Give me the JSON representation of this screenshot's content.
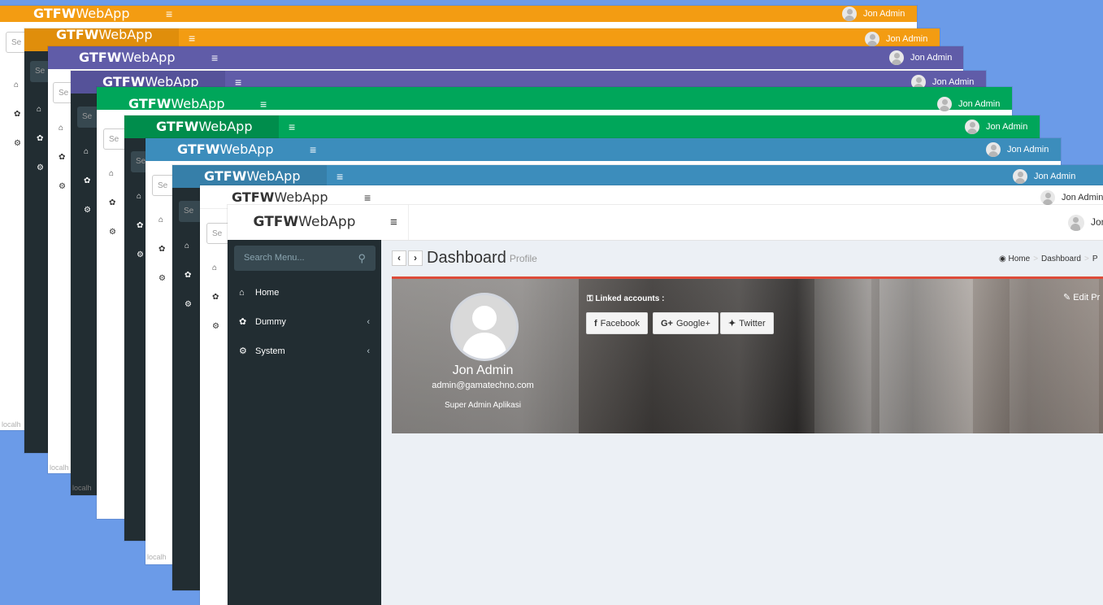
{
  "app": {
    "brand_bold": "GTFW",
    "brand_rest": "WebApp",
    "user_name": "Jon Admin",
    "menu_glyph": "≡"
  },
  "colors": {
    "orange": "#f39c12",
    "purple": "#605ca8",
    "green": "#00a65a",
    "blue": "#3c8dbc",
    "sidebar_dark": "#222d32",
    "red_accent": "#dd4b39"
  },
  "background_windows": {
    "search_placeholder_partial": "Se",
    "footer_partial": "localh"
  },
  "sidebar": {
    "search_placeholder": "Search Menu...",
    "items": [
      {
        "label": "Home",
        "icon": "home-icon",
        "has_submenu": false
      },
      {
        "label": "Dummy",
        "icon": "paw-icon",
        "has_submenu": true
      },
      {
        "label": "System",
        "icon": "gear-icon",
        "has_submenu": true
      }
    ]
  },
  "content": {
    "title": "Dashboard",
    "subtitle": "Profile",
    "breadcrumb": [
      "Home",
      "Dashboard",
      "P"
    ]
  },
  "profile": {
    "name": "Jon Admin",
    "email": "admin@gamatechno.com",
    "role": "Super Admin Aplikasi",
    "linked_label": "Linked accounts :",
    "social": [
      "Facebook",
      "Google+",
      "Twitter"
    ],
    "edit_label": "Edit Pr"
  }
}
